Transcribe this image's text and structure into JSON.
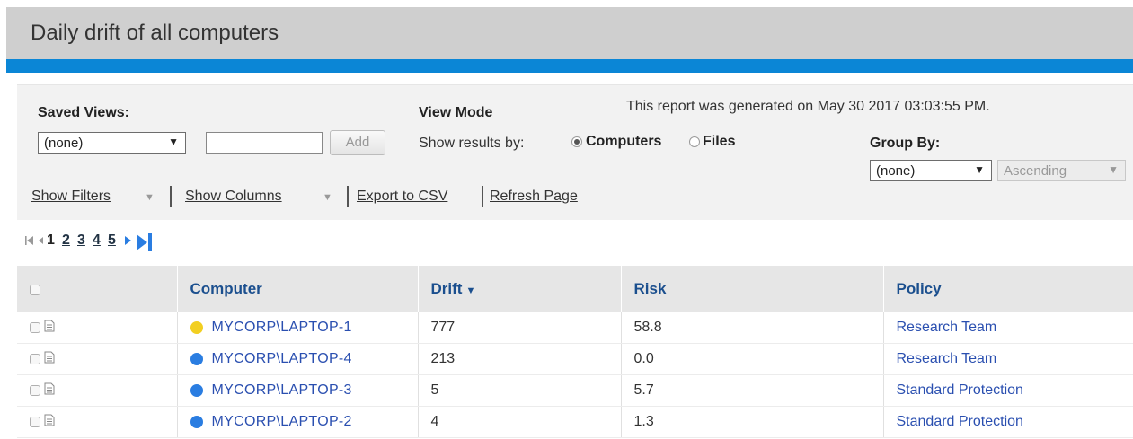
{
  "page": {
    "title": "Daily drift of all computers",
    "accent_color": "#0b86d6"
  },
  "toolbar": {
    "saved_views_label": "Saved Views:",
    "saved_views_value": "(none)",
    "saved_view_name_value": "",
    "add_label": "Add",
    "view_mode_label": "View Mode",
    "show_results_label": "Show results by:",
    "option_computers": "Computers",
    "option_files": "Files",
    "selected_mode": "Computers",
    "generated_text": "This report was generated on May 30 2017 03:03:55 PM.",
    "group_by_label": "Group By:",
    "group_by_value": "(none)",
    "order_value": "Ascending",
    "show_filters": "Show Filters",
    "show_columns": "Show Columns",
    "export_csv": "Export to CSV",
    "refresh_page": "Refresh Page"
  },
  "pager": {
    "current_page": "1",
    "pages": [
      "2",
      "3",
      "4",
      "5"
    ]
  },
  "table": {
    "columns": [
      "Computer",
      "Drift",
      "Risk",
      "Policy"
    ],
    "sorted_column": "Drift",
    "rows": [
      {
        "status_color": "#f2cf21",
        "computer": "MYCORP\\LAPTOP-1",
        "drift": "777",
        "risk": "58.8",
        "policy": "Research Team"
      },
      {
        "status_color": "#2a7de1",
        "computer": "MYCORP\\LAPTOP-4",
        "drift": "213",
        "risk": "0.0",
        "policy": "Research Team"
      },
      {
        "status_color": "#2a7de1",
        "computer": "MYCORP\\LAPTOP-3",
        "drift": "5",
        "risk": "5.7",
        "policy": "Standard Protection"
      },
      {
        "status_color": "#2a7de1",
        "computer": "MYCORP\\LAPTOP-2",
        "drift": "4",
        "risk": "1.3",
        "policy": "Standard Protection"
      }
    ]
  }
}
